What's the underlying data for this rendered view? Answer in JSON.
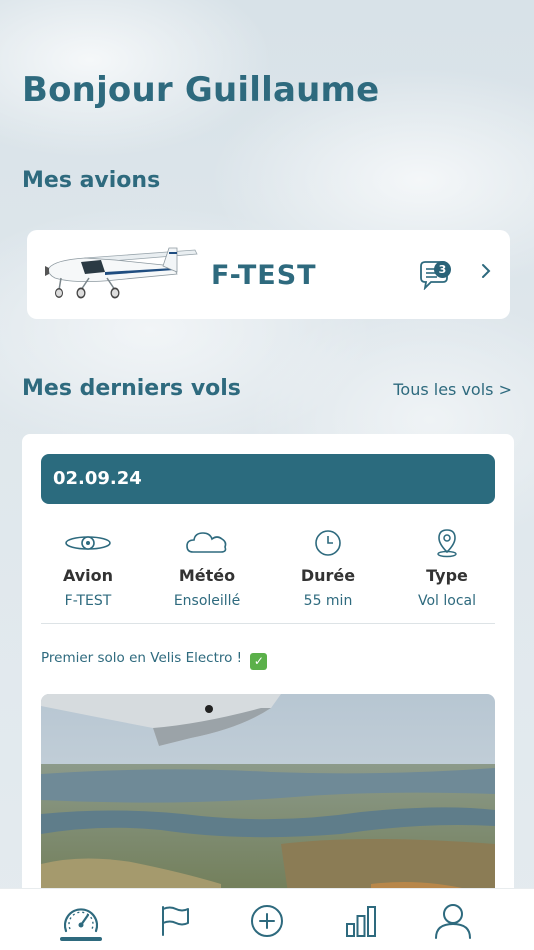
{
  "greeting": "Bonjour Guillaume",
  "planes_section": {
    "title": "Mes avions",
    "plane": {
      "registration": "F-TEST",
      "message_count": "3"
    }
  },
  "flights_section": {
    "title": "Mes derniers vols",
    "all_link": "Tous les vols >",
    "flight": {
      "date": "02.09.24",
      "stats": [
        {
          "label": "Avion",
          "value": "F-TEST",
          "icon": "propeller-icon"
        },
        {
          "label": "Météo",
          "value": "Ensoleillé",
          "icon": "cloud-icon"
        },
        {
          "label": "Durée",
          "value": "55 min",
          "icon": "clock-icon"
        },
        {
          "label": "Type",
          "value": "Vol local",
          "icon": "location-pin-icon"
        }
      ],
      "note": "Premier solo en Velis Electro !",
      "note_emoji": "✓"
    }
  },
  "tabbar": {
    "tabs": [
      "dashboard",
      "flag",
      "add",
      "stats",
      "profile"
    ],
    "active": "dashboard"
  },
  "colors": {
    "primary": "#2e6a7e",
    "date_bar": "#2b6b7e",
    "check": "#5bb04a"
  }
}
